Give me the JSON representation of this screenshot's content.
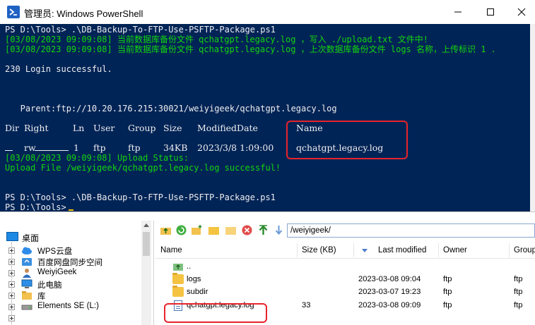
{
  "window": {
    "title": "管理员: Windows PowerShell"
  },
  "console": {
    "lines": [
      {
        "text": "PS D:\\Tools> .\\DB-Backup-To-FTP-Use-PSFTP-Package.ps1",
        "color": "#eeedf0"
      },
      {
        "text": "[03/08/2023 09:09:08] 当前数据库备份文件 qchatgpt.legacy.log ，写入 ./upload.txt 文件中!",
        "color": "#13d40f"
      },
      {
        "text": "[03/08/2023 09:09:08] 当前数据库备份文件 qchatgpt.legacy.log ，上次数据库备份文件 logs 名称，上传标识 1 .",
        "color": "#13d40f"
      },
      {
        "text": "230 Login successful.",
        "color": "#eeedf0"
      },
      {
        "text": "   Parent:ftp://10.20.176.215:30021/weiyigeek/qchatgpt.legacy.log",
        "color": "#eeedf0"
      },
      {
        "text": "[03/08/2023 09:09:08] Upload Status:",
        "color": "#13d40f"
      },
      {
        "text": "Upload File /weiyigeek/qchatgpt.legacy.log successful!",
        "color": "#13d40f"
      },
      {
        "text": "PS D:\\Tools> .\\DB-Backup-To-FTP-Use-PSFTP-Package.ps1",
        "color": "#eeedf0"
      },
      {
        "text": "PS D:\\Tools> ",
        "color": "#eeedf0"
      }
    ],
    "table_headers": [
      "Dir",
      "Right",
      "Ln",
      "User",
      "Group",
      "Size",
      "ModifiedDate",
      "Name"
    ],
    "table_row": {
      "dir": "",
      "right": "rw",
      "ln": "1",
      "user": "ftp",
      "group": "ftp",
      "size": "34KB",
      "modified": "2023/3/8 1:09:00",
      "name": "qchatgpt.legacy.log"
    }
  },
  "file_manager": {
    "tree": {
      "root": "桌面",
      "items": [
        {
          "label": "WPS云盘",
          "icon": "cloud-icon"
        },
        {
          "label": "百度网盘同步空间",
          "icon": "sync-folder-icon"
        },
        {
          "label": "WeiyiGeek",
          "icon": "user-icon"
        },
        {
          "label": "此电脑",
          "icon": "computer-icon"
        },
        {
          "label": "库",
          "icon": "library-icon"
        },
        {
          "label": "Elements SE (L:)",
          "icon": "drive-icon"
        }
      ]
    },
    "path": "/weiyigeek/",
    "columns": [
      "Name",
      "Size (KB)",
      "Last modified",
      "Owner",
      "Group"
    ],
    "rows": [
      {
        "name": "..",
        "size": "",
        "modified": "",
        "owner": "",
        "group": "",
        "type": "parent"
      },
      {
        "name": "logs",
        "size": "",
        "modified": "2023-03-08 09:04",
        "owner": "ftp",
        "group": "ftp",
        "type": "folder"
      },
      {
        "name": "subdir",
        "size": "",
        "modified": "2023-03-07 19:23",
        "owner": "ftp",
        "group": "ftp",
        "type": "folder"
      },
      {
        "name": "qchatgpt.legacy.log",
        "size": "33",
        "modified": "2023-03-08 09:09",
        "owner": "ftp",
        "group": "ftp",
        "type": "file"
      }
    ]
  },
  "colors": {
    "console_bg": "#012456",
    "console_text": "#eeedf0",
    "console_green": "#13d40f",
    "highlight_red": "#e8242a"
  }
}
